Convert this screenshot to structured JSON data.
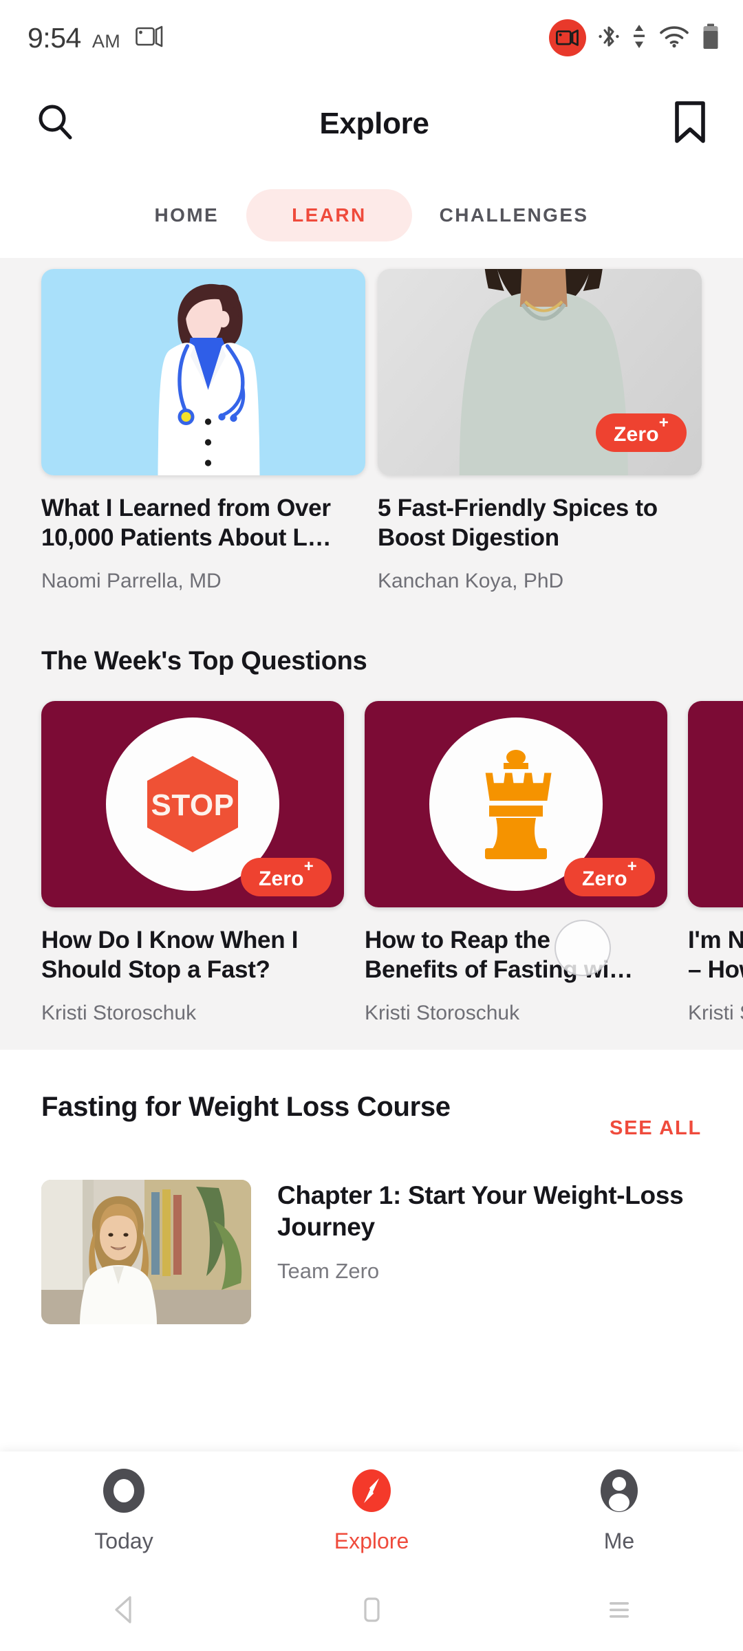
{
  "status_bar": {
    "time": "9:54",
    "ampm": "AM",
    "icons": [
      "screen-cast-icon",
      "screen-record-icon",
      "bluetooth-icon",
      "data-transfer-icon",
      "wifi-icon",
      "battery-icon"
    ]
  },
  "header": {
    "title": "Explore",
    "search_icon": "search-icon",
    "bookmark_icon": "bookmark-icon"
  },
  "tabs": [
    {
      "label": "HOME",
      "active": false
    },
    {
      "label": "LEARN",
      "active": true
    },
    {
      "label": "CHALLENGES",
      "active": false
    }
  ],
  "articles": [
    {
      "title": "What I Learned from Over 10,000 Patients About L…",
      "author": "Naomi Parrella, MD",
      "image": "doctor-illustration",
      "badge": null
    },
    {
      "title": "5 Fast-Friendly Spices to Boost Digestion",
      "author": "Kanchan Koya, PhD",
      "image": "woman-portrait-photo",
      "badge": "Zero"
    }
  ],
  "questions_section": {
    "heading": "The Week's Top Questions",
    "cards": [
      {
        "title": "How Do I Know When I\nShould Stop a Fast?",
        "author": "Kristi Storoschuk",
        "icon": "stop-sign-icon",
        "badge": "Zero"
      },
      {
        "title": "How to Reap the\nBenefits of Fasting wi…",
        "author": "Kristi Storoschuk",
        "icon": "chess-queen-icon",
        "badge": "Zero"
      },
      {
        "title": "I'm Ne\n– How",
        "author": "Kristi S",
        "icon": "partial-icon",
        "badge": null
      }
    ]
  },
  "course_section": {
    "title": "Fasting for Weight Loss Course",
    "see_all": "SEE ALL",
    "chapter": {
      "title": "Chapter 1: Start Your Weight-Loss Journey",
      "author": "Team Zero",
      "image": "woman-indoor-photo"
    }
  },
  "bottom_nav": [
    {
      "label": "Today",
      "icon": "ring-icon",
      "active": false
    },
    {
      "label": "Explore",
      "icon": "compass-icon",
      "active": true
    },
    {
      "label": "Me",
      "icon": "person-icon",
      "active": false
    }
  ],
  "android_nav": [
    {
      "icon": "back-triangle-icon"
    },
    {
      "icon": "home-square-icon"
    },
    {
      "icon": "recents-menu-icon"
    }
  ],
  "colors": {
    "accent_red": "#ef4b3c",
    "badge_red": "#ee4230",
    "card_maroon": "#7c0b35",
    "icon_orange": "#f59300",
    "gray_bg": "#f4f3f3"
  }
}
